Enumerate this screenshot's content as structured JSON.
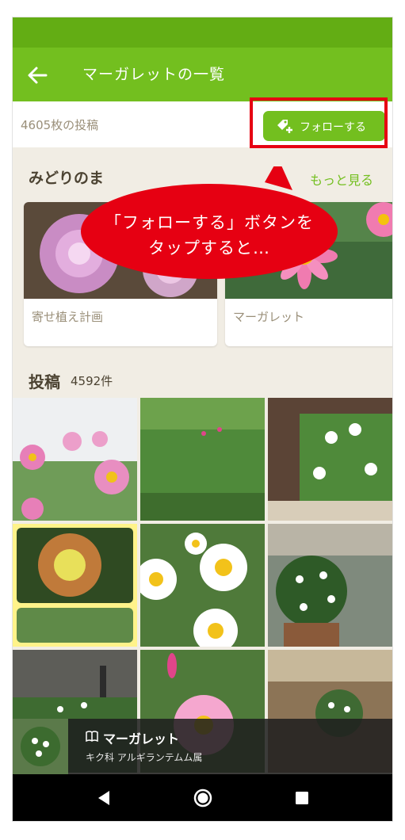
{
  "app_bar": {
    "title": "マーガレットの一覧",
    "back_icon": "arrow-left-icon"
  },
  "follow_bar": {
    "post_count": "4605枚の投稿",
    "follow_label": "フォローする",
    "follow_icon": "tag-plus-icon"
  },
  "featured": {
    "heading": "みどりのま",
    "more_label": "もっと見る",
    "cards": [
      {
        "label": "寄せ植え計画"
      },
      {
        "label": "マーガレット"
      }
    ]
  },
  "callout": {
    "line1": "「フォローする」ボタンを",
    "line2": "タップすると…"
  },
  "posts": {
    "title": "投稿",
    "count": "4592件"
  },
  "plant_info": {
    "name": "マーガレット",
    "family": "キク科 アルギランテムム属",
    "icon": "book-icon"
  },
  "nav": {
    "back_icon": "triangle-back-icon",
    "home_icon": "circle-home-icon",
    "recent_icon": "square-recent-icon"
  },
  "colors": {
    "accent": "#73bf1f",
    "status_bar": "#63ad14",
    "highlight": "#e60012"
  }
}
